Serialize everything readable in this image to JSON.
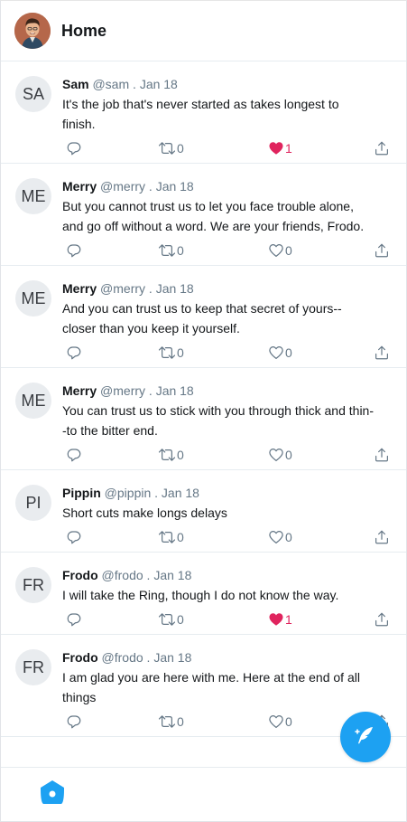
{
  "header": {
    "title": "Home"
  },
  "colors": {
    "accent": "#1da1f2",
    "like": "#e0245e",
    "muted": "#657786"
  },
  "tweets": [
    {
      "initials": "SA",
      "name": "Sam",
      "handle": "@sam .",
      "date": "Jan 18",
      "text": "It's the job that's never started as takes longest to finish.",
      "retweets": "0",
      "likes": "1",
      "liked": true
    },
    {
      "initials": "ME",
      "name": "Merry",
      "handle": "@merry .",
      "date": "Jan 18",
      "text": "But you cannot trust us to let you face trouble alone, and go off without a word. We are your friends, Frodo.",
      "retweets": "0",
      "likes": "0",
      "liked": false
    },
    {
      "initials": "ME",
      "name": "Merry",
      "handle": "@merry .",
      "date": "Jan 18",
      "text": "And you can trust us to keep that secret of yours--closer than you keep it yourself.",
      "retweets": "0",
      "likes": "0",
      "liked": false
    },
    {
      "initials": "ME",
      "name": "Merry",
      "handle": "@merry .",
      "date": "Jan 18",
      "text": "You can trust us to stick with you through thick and thin--to the bitter end.",
      "retweets": "0",
      "likes": "0",
      "liked": false
    },
    {
      "initials": "PI",
      "name": "Pippin",
      "handle": "@pippin .",
      "date": "Jan 18",
      "text": "Short cuts make longs delays",
      "retweets": "0",
      "likes": "0",
      "liked": false
    },
    {
      "initials": "FR",
      "name": "Frodo",
      "handle": "@frodo .",
      "date": "Jan 18",
      "text": "I will take the Ring, though I do not know the way.",
      "retweets": "0",
      "likes": "1",
      "liked": true
    },
    {
      "initials": "FR",
      "name": "Frodo",
      "handle": "@frodo .",
      "date": "Jan 18",
      "text": "I am glad you are here with me. Here at the end of all things",
      "retweets": "0",
      "likes": "0",
      "liked": false
    }
  ],
  "icons": {
    "reply": "reply-icon",
    "retweet": "retweet-icon",
    "like": "heart-icon",
    "share": "share-icon",
    "home": "home-icon",
    "compose": "feather-icon"
  }
}
